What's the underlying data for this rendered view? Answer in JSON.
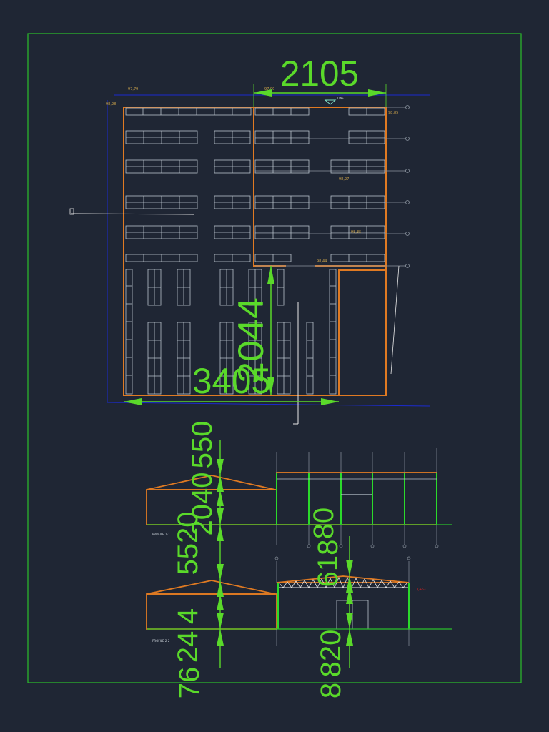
{
  "drawing": {
    "dimensions": {
      "top_width": "2105",
      "bottom_width": "3405",
      "vertical_mid": "2044",
      "elev_left_top": "550",
      "elev_left_mid": "2040",
      "elev_left_mid2": "5520",
      "elev_left_bottom": "24",
      "elev_left_side": "76",
      "elev_left_side2": "4",
      "elev_right_upper": "80",
      "elev_right_mid": "618",
      "elev_right_bottom": "820",
      "elev_right_bottom2": "8"
    },
    "level_tags": {
      "t1": "97,79",
      "t2": "97,90",
      "t3": "98,28",
      "t4": "98,85",
      "t5": "98,27",
      "t6": "98,44",
      "t7": "98,35"
    },
    "section_labels": {
      "s1": "PROFILE 1-1",
      "s2": "PROFILE 2-2"
    },
    "marker_label": "LINE",
    "red_note": "(+/-)"
  },
  "colors": {
    "background": "#1f2634",
    "frame": "#2bbf2b",
    "dimension": "#5ad92a",
    "wall": "#e07a22",
    "survey": "#1b2bd0",
    "rack": "#b9c3cc",
    "note": "#e02020"
  }
}
